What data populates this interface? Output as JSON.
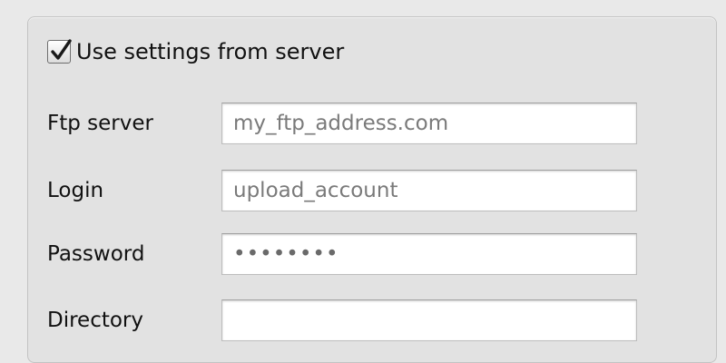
{
  "settings": {
    "use_server_settings": {
      "label": "Use settings from server",
      "checked": true
    },
    "fields": {
      "ftp_server": {
        "label": "Ftp server",
        "value": "my_ftp_address.com"
      },
      "login": {
        "label": "Login",
        "value": "upload_account"
      },
      "password": {
        "label": "Password",
        "value": "••••••••"
      },
      "directory": {
        "label": "Directory",
        "value": ""
      }
    }
  },
  "colors": {
    "background": "#e9e9e9",
    "panel": "#e2e2e2",
    "field_bg": "#ffffff",
    "field_text": "#7a7a7a"
  },
  "icons": {
    "checkbox": "checkmark-icon"
  }
}
